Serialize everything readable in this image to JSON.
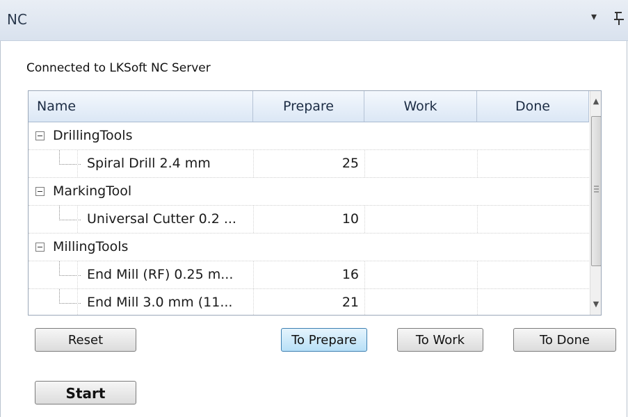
{
  "window": {
    "title": "NC",
    "dropdown_glyph": "▾",
    "pin_glyph": "⊥"
  },
  "status_text": "Connected to LKSoft NC Server",
  "grid": {
    "columns": [
      "Name",
      "Prepare",
      "Work",
      "Done"
    ],
    "rows": [
      {
        "type": "group",
        "name": "DrillingTools"
      },
      {
        "type": "child",
        "name": "Spiral Drill 2.4 mm",
        "prepare": "25",
        "work": "",
        "done": ""
      },
      {
        "type": "group",
        "name": "MarkingTool"
      },
      {
        "type": "child",
        "name": "Universal Cutter 0.2 ...",
        "prepare": "10",
        "work": "",
        "done": ""
      },
      {
        "type": "group",
        "name": "MillingTools"
      },
      {
        "type": "child",
        "name": "End Mill (RF) 0.25 m...",
        "prepare": "16",
        "work": "",
        "done": ""
      },
      {
        "type": "child",
        "name": "End Mill 3.0 mm (11...",
        "prepare": "21",
        "work": "",
        "done": ""
      }
    ]
  },
  "buttons": {
    "reset": "Reset",
    "to_prepare": "To Prepare",
    "to_work": "To Work",
    "to_done": "To Done",
    "start": "Start"
  },
  "icons": {
    "collapse": "minus-box-icon",
    "scroll_up": "▲",
    "scroll_down": "▼"
  }
}
